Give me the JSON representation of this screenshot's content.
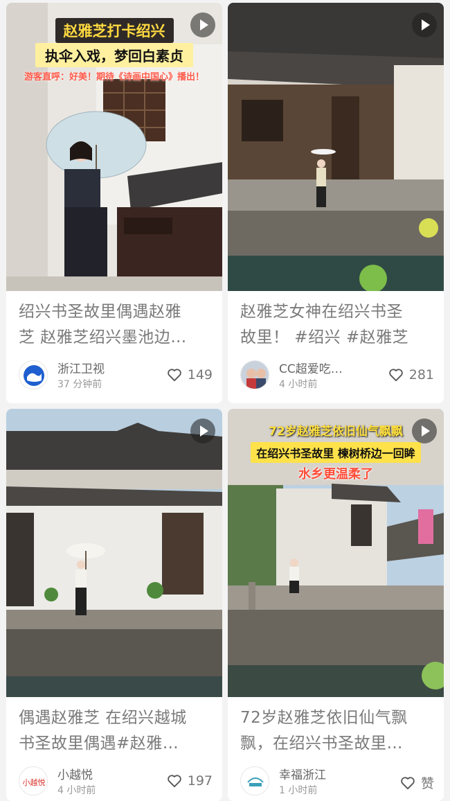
{
  "cards": [
    {
      "overlay": [
        "赵雅芝打卡绍兴",
        "执伞入戏，梦回白素贞",
        "游客直呼：好美！期待《诗画中国心》播出！"
      ],
      "title_lines": [
        "绍兴书圣故里偶遇赵雅",
        "芝 赵雅芝绍兴墨池边…"
      ],
      "author": "浙江卫视",
      "time": "37 分钟前",
      "likes": "149",
      "avatar": "zhejiang-tv-logo"
    },
    {
      "overlay": [],
      "title_lines": [
        "赵雅芝女神在绍兴书圣",
        "故里！ #绍兴 #赵雅芝"
      ],
      "author": "CC超爱吃…",
      "time": "4 小时前",
      "likes": "281",
      "avatar": "user-photo"
    },
    {
      "overlay": [],
      "title_lines": [
        "偶遇赵雅芝 在绍兴越城",
        "书圣故里偶遇#赵雅…"
      ],
      "author": "小越悦",
      "time": "4 小时前",
      "likes": "197",
      "avatar": "xiaoyueyue-logo"
    },
    {
      "overlay": [
        "72岁赵雅芝依旧仙气飘飘",
        "在绍兴书圣故里 楝树桥边一回眸",
        "水乡更温柔了"
      ],
      "title_lines": [
        "72岁赵雅芝依旧仙气飘",
        "飘，在绍兴书圣故里…"
      ],
      "author": "幸福浙江",
      "time": "1 小时前",
      "likes": "赞",
      "avatar": "xingfu-zhejiang-logo"
    }
  ],
  "colors": {
    "background": "#f3f3f3",
    "card": "#ffffff",
    "title_text": "#7a7a7a",
    "caption_yellow": "#ffd940",
    "caption_red": "#ff5a4a"
  },
  "icons": {
    "play": "play-icon",
    "like": "heart-outline-icon"
  }
}
